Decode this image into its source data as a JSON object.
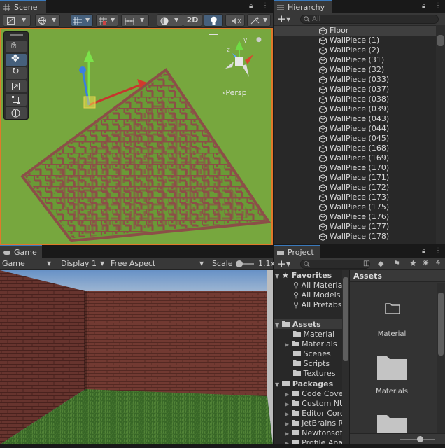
{
  "scene": {
    "tab": "Scene",
    "toggle_2d": "2D",
    "persp": "‹Persp",
    "axis_y": "y",
    "axis_z": "z"
  },
  "hierarchy": {
    "tab": "Hierarchy",
    "search_placeholder": "All",
    "add": "+",
    "items": [
      "Floor",
      "WallPiece (1)",
      "WallPiece (2)",
      "WallPiece (31)",
      "WallPiece (32)",
      "WallPiece (033)",
      "WallPiece (037)",
      "WallPiece (038)",
      "WallPiece (039)",
      "WallPiece (043)",
      "WallPiece (044)",
      "WallPiece (045)",
      "WallPiece (168)",
      "WallPiece (169)",
      "WallPiece (170)",
      "WallPiece (171)",
      "WallPiece (172)",
      "WallPiece (173)",
      "WallPiece (175)",
      "WallPiece (176)",
      "WallPiece (177)",
      "WallPiece (178)"
    ]
  },
  "game": {
    "tab": "Game",
    "mode": "Game",
    "display": "Display 1",
    "aspect": "Free Aspect",
    "scale_label": "Scale",
    "scale_value": "1.1x"
  },
  "project": {
    "tab": "Project",
    "add": "+",
    "hidden_count": "4",
    "favorites": {
      "label": "Favorites",
      "items": [
        "All Materia",
        "All Models",
        "All Prefabs"
      ]
    },
    "assets": {
      "label": "Assets",
      "items": [
        "Material",
        "Materials",
        "Scenes",
        "Scripts",
        "Textures"
      ]
    },
    "packages": {
      "label": "Packages",
      "items": [
        "Code Cove",
        "Custom NU",
        "Editor Coro",
        "JetBrains R",
        "Newtonsof",
        "Profile Ana"
      ]
    },
    "content_header": "Assets",
    "content_items": [
      "Material",
      "Materials"
    ],
    "zoom_fraction": 0.55
  },
  "colors": {
    "accent_blue": "#3a79bb",
    "scene_border": "#e0792a",
    "ground_green": "#77a73e",
    "maze_wall": "#8c4f48",
    "panel_bg": "#282828",
    "toolbar_bg": "#383838"
  }
}
